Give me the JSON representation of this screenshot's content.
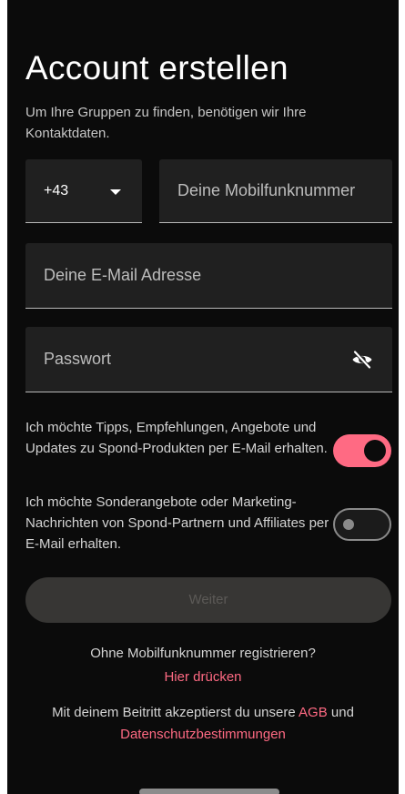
{
  "header": {
    "title": "Account erstellen",
    "subtitle": "Um Ihre Gruppen zu finden, benötigen wir Ihre Kontaktdaten."
  },
  "form": {
    "country_code": "+43",
    "phone_placeholder": "Deine Mobilfunknummer",
    "email_placeholder": "Deine E-Mail Adresse",
    "password_placeholder": "Passwort",
    "password_visibility_icon": "eye-off-icon"
  },
  "consents": [
    {
      "text": "Ich möchte Tipps, Empfehlungen, Angebote und Updates zu Spond-Produkten per E-Mail erhalten.",
      "enabled": true
    },
    {
      "text": "Ich möchte Sonderangebote oder Marketing-Nachrichten von Spond-Partnern und Affiliates per E-Mail erhalten.",
      "enabled": false
    }
  ],
  "actions": {
    "continue_label": "Weiter",
    "no_phone_prompt": "Ohne Mobilfunknummer registrieren?",
    "click_here_link": "Hier drücken"
  },
  "terms": {
    "prefix": "Mit deinem Beitritt akzeptierst du unsere ",
    "agb_link": "AGB",
    "connector": " und",
    "privacy_link": "Datenschutzbestimmungen"
  },
  "colors": {
    "background": "#0b0b0b",
    "field": "#202020",
    "accent": "#ff6a83",
    "disabled_button": "#373634"
  }
}
